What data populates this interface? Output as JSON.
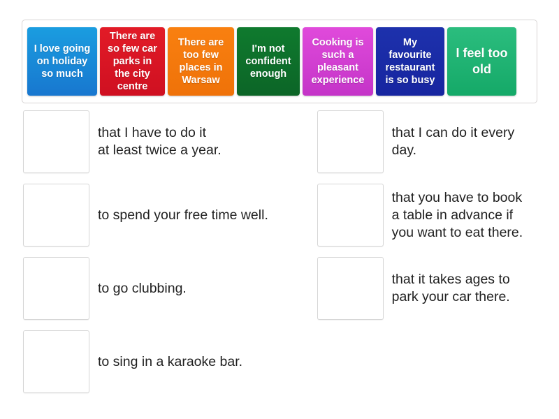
{
  "tray": {
    "name": "draggable-tile-tray",
    "tiles": [
      {
        "text": "I love\ngoing on\nholiday\nso much",
        "color": "#1a8fdc"
      },
      {
        "text": "There are\nso few car\nparks in the\ncity centre",
        "color": "#d8141f"
      },
      {
        "text": "There are\ntoo few\nplaces in\nWarsaw",
        "color": "#f4780c"
      },
      {
        "text": "I'm not\nconfident\nenough",
        "color": "#0e7029"
      },
      {
        "text": "Cooking\nis such\na pleasant\nexperience",
        "color": "#d63fd2"
      },
      {
        "text": "My\nfavourite\nrestaurant\nis so busy",
        "color": "#1a2ba6"
      },
      {
        "text": "I feel\ntoo old",
        "color": "#1fb373"
      }
    ]
  },
  "answers": {
    "left_column": [
      {
        "drop_label": "",
        "text": "that I have to do it\nat least twice a year."
      },
      {
        "drop_label": "",
        "text": "to spend your free time well."
      },
      {
        "drop_label": "",
        "text": "to go clubbing."
      },
      {
        "drop_label": "",
        "text": "to sing in a karaoke bar."
      }
    ],
    "right_column": [
      {
        "drop_label": "",
        "text": "that I can do it every day."
      },
      {
        "drop_label": "",
        "text": "that you have to book\na table in advance if\nyou want to eat there."
      },
      {
        "drop_label": "",
        "text": "that it takes ages to\npark your car there."
      }
    ]
  }
}
